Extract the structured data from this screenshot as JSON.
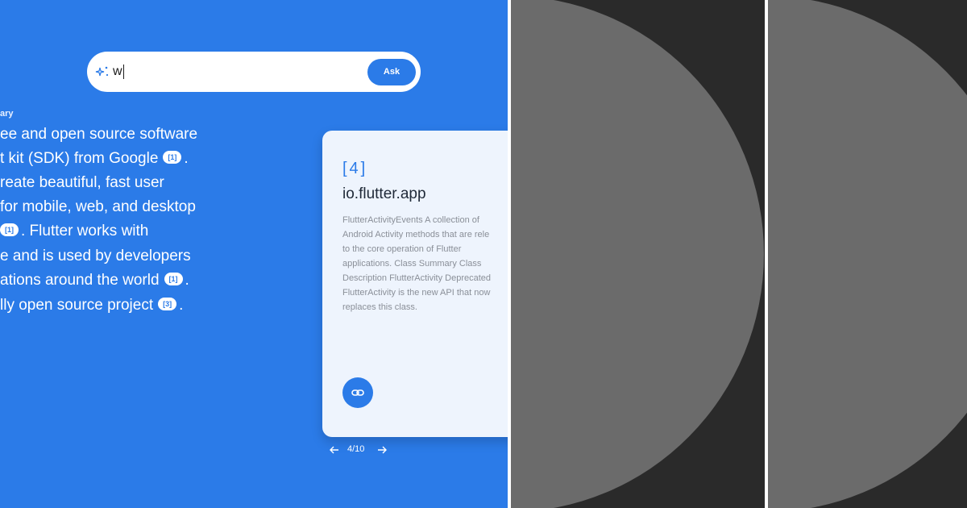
{
  "search": {
    "query": "w",
    "ask_label": "Ask"
  },
  "summary": {
    "label": "ary",
    "lines": [
      {
        "text": "ee and open source software",
        "cite": ""
      },
      {
        "text": "t kit (SDK) from Google",
        "cite": "[1]",
        "after": "."
      },
      {
        "text": "reate beautiful, fast user",
        "cite": ""
      },
      {
        "text": " for mobile, web, and desktop",
        "cite": ""
      },
      {
        "text": "",
        "cite": "[1]",
        "after": ". Flutter works with"
      },
      {
        "text": "e and is used by developers",
        "cite": ""
      },
      {
        "text": "ations around the world",
        "cite": "[1]",
        "after": "."
      },
      {
        "text": "lly open source project",
        "cite": "[3]",
        "after": "."
      }
    ]
  },
  "card": {
    "index": "[4]",
    "title": "io.flutter.app",
    "description_lines": [
      "FlutterActivityEvents A collection of",
      "Android Activity methods that are rele",
      "to the core operation of Flutter",
      "applications. Class Summary Class",
      "Description FlutterActivity Deprecated",
      "FlutterActivity is the new API that now",
      "replaces this class."
    ]
  },
  "pager": {
    "text": "4/10"
  },
  "colors": {
    "accent": "#2b7be8",
    "card_bg": "#eef4fd",
    "dark_panel": "#2a2a2a",
    "circle": "#6b6b6b"
  },
  "icons": {
    "search": "sparkle-icon",
    "link": "link-icon",
    "prev": "arrow-left-icon",
    "next": "arrow-right-icon"
  }
}
